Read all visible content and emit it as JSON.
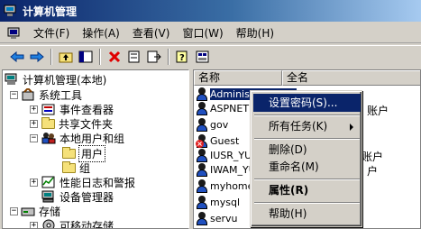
{
  "window": {
    "title": "计算机管理"
  },
  "menu": [
    "文件(F)",
    "操作(A)",
    "查看(V)",
    "窗口(W)",
    "帮助(H)"
  ],
  "toolbar": {
    "icons": [
      "back-arrow-icon",
      "forward-arrow-icon",
      "up-folder-icon",
      "show-tree-icon",
      "delete-icon",
      "properties-icon",
      "export-icon",
      "help-icon",
      "console-icon"
    ]
  },
  "tree": {
    "root": "计算机管理(本地)",
    "system_tools": "系统工具",
    "event_viewer": "事件查看器",
    "shared_folders": "共享文件夹",
    "local_users": "本地用户和组",
    "users": "用户",
    "groups": "组",
    "perf_logs": "性能日志和警报",
    "device_manager": "设备管理器",
    "storage": "存储",
    "removable": "可移动存储"
  },
  "list": {
    "headers": {
      "name": "名称",
      "fullname": "全名"
    },
    "rows": [
      {
        "name": "Adminis"
      },
      {
        "name": "ASPNET"
      },
      {
        "name": "gov"
      },
      {
        "name": "Guest"
      },
      {
        "name": "IUSR_YU"
      },
      {
        "name": "IWAM_YU"
      },
      {
        "name": "myhome"
      },
      {
        "name": "mysql"
      },
      {
        "name": "servu"
      }
    ],
    "peek": {
      "aspnet_tail": "账户",
      "iusr_tail": "账户",
      "iwam_tail": "户"
    }
  },
  "context_menu": {
    "set_password": "设置密码(S)...",
    "all_tasks": "所有任务(K)",
    "delete": "删除(D)",
    "rename": "重命名(M)",
    "properties": "属性(R)",
    "help": "帮助(H)"
  },
  "colors": {
    "selection": "#0a246a",
    "face": "#d4d0c8"
  }
}
